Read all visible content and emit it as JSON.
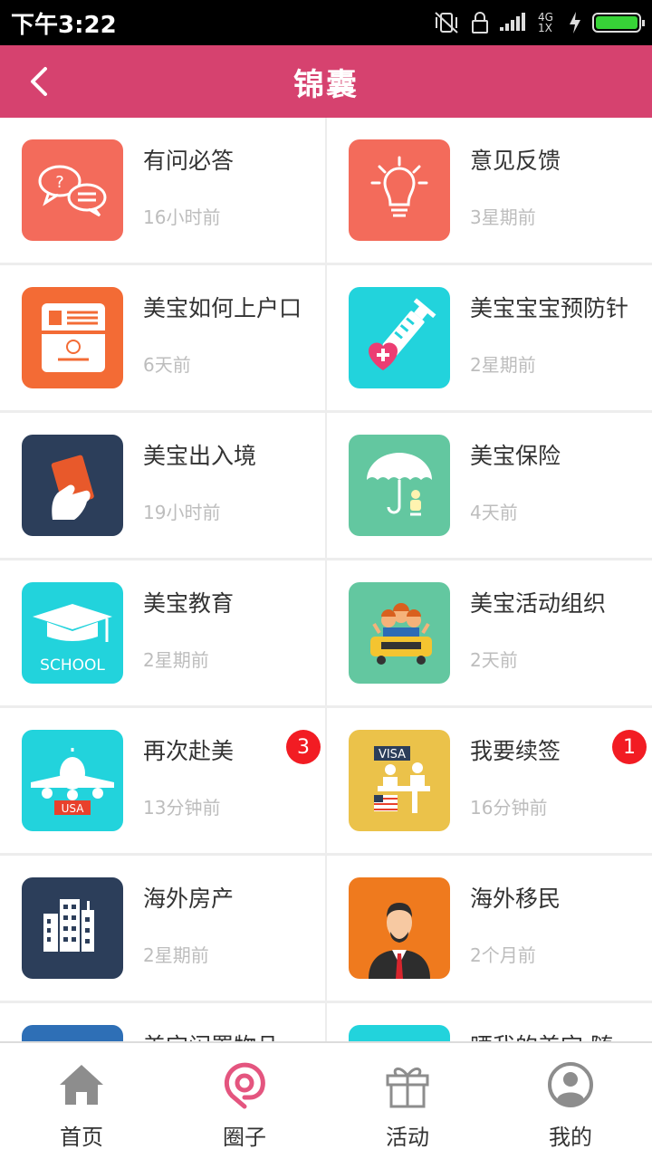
{
  "status_bar": {
    "time": "下午3:22",
    "network": "4G 1X"
  },
  "header": {
    "title": "锦囊"
  },
  "accent_color": "#d6426f",
  "items": [
    {
      "name": "有问必答",
      "time": "16小时前",
      "icon": "qa-chat-icon",
      "color": "#f36b5b"
    },
    {
      "name": "意见反馈",
      "time": "3星期前",
      "icon": "lightbulb-icon",
      "color": "#f36b5b"
    },
    {
      "name": "美宝如何上户口",
      "time": "6天前",
      "icon": "household-register-icon",
      "color": "#f36b35"
    },
    {
      "name": "美宝宝宝预防针",
      "time": "2星期前",
      "icon": "syringe-icon",
      "color": "#22d3dc"
    },
    {
      "name": "美宝出入境",
      "time": "19小时前",
      "icon": "passport-icon",
      "color": "#2c3e5a"
    },
    {
      "name": "美宝保险",
      "time": "4天前",
      "icon": "umbrella-baby-icon",
      "color": "#63c7a0"
    },
    {
      "name": "美宝教育",
      "time": "2星期前",
      "icon": "graduation-cap-icon",
      "color": "#22d3dc",
      "icon_text": "SCHOOL"
    },
    {
      "name": "美宝活动组织",
      "time": "2天前",
      "icon": "family-car-icon",
      "color": "#63c7a0"
    },
    {
      "name": "再次赴美",
      "time": "13分钟前",
      "icon": "airplane-icon",
      "color": "#22d3dc",
      "badge": "3",
      "icon_text": "USA"
    },
    {
      "name": "我要续签",
      "time": "16分钟前",
      "icon": "visa-counter-icon",
      "color": "#ebc24a",
      "badge": "1",
      "icon_text": "VISA"
    },
    {
      "name": "海外房产",
      "time": "2星期前",
      "icon": "buildings-icon",
      "color": "#2c3e5a"
    },
    {
      "name": "海外移民",
      "time": "2个月前",
      "icon": "businessman-icon",
      "color": "#ef7a1e"
    },
    {
      "name": "美宝闲置物品",
      "time": "",
      "icon": "partial-icon",
      "color": "#2e6fb6"
    },
    {
      "name": "晒我的美宝 随",
      "time": "",
      "icon": "partial-icon",
      "color": "#22d3dc"
    }
  ],
  "bottom_nav": [
    {
      "label": "首页",
      "icon": "home-icon",
      "active": false
    },
    {
      "label": "圈子",
      "icon": "circle-location-icon",
      "active": true
    },
    {
      "label": "活动",
      "icon": "gift-icon",
      "active": false
    },
    {
      "label": "我的",
      "icon": "profile-icon",
      "active": false
    }
  ]
}
